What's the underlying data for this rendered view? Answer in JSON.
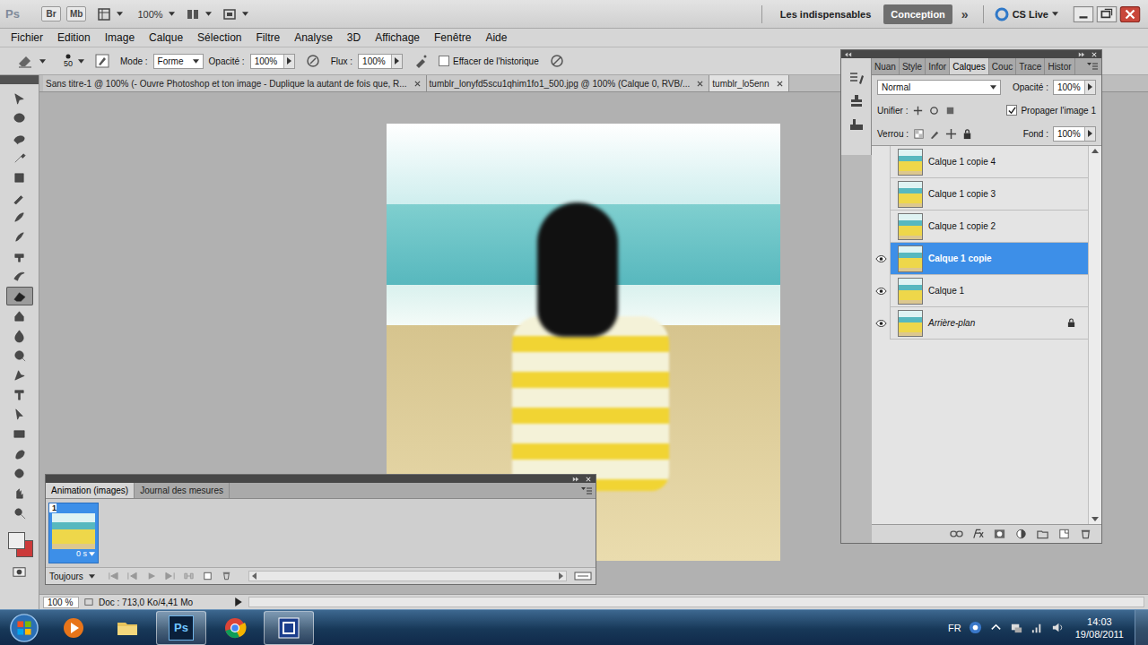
{
  "app_bar": {
    "logo": "Ps",
    "bridge_buttons": [
      "Br",
      "Mb"
    ],
    "zoom": "100%",
    "workspaces": [
      {
        "label": "Les indispensables",
        "selected": false
      },
      {
        "label": "Conception",
        "selected": true
      }
    ],
    "more": "»",
    "cs_live": "CS Live"
  },
  "menu": [
    "Fichier",
    "Edition",
    "Image",
    "Calque",
    "Sélection",
    "Filtre",
    "Analyse",
    "3D",
    "Affichage",
    "Fenêtre",
    "Aide"
  ],
  "options": {
    "brush_size": "50",
    "mode_label": "Mode :",
    "mode_value": "Forme",
    "opacity_label": "Opacité :",
    "opacity": "100%",
    "flow_label": "Flux :",
    "flow": "100%",
    "erase_history": {
      "label": "Effacer de l'historique",
      "checked": false
    }
  },
  "doc_tabs": [
    {
      "label": "Sans titre-1 @ 100% (- Ouvre Photoshop et ton image - Duplique la autant de fois que, R...",
      "selected": false
    },
    {
      "label": "tumblr_lonyfd5scu1qhim1fo1_500.jpg @ 100% (Calque 0, RVB/...",
      "selected": false
    },
    {
      "label": "tumblr_lo5enn",
      "selected": true
    }
  ],
  "tools": [
    {
      "selected": false
    },
    {
      "selected": false
    },
    {
      "selected": false
    },
    {
      "selected": false
    },
    {
      "selected": false
    },
    {
      "selected": false
    },
    {
      "selected": false
    },
    {
      "selected": false
    },
    {
      "selected": false
    },
    {
      "selected": false
    },
    {
      "selected": true
    },
    {
      "selected": false
    },
    {
      "selected": false
    },
    {
      "selected": false
    },
    {
      "selected": false
    },
    {
      "selected": false
    },
    {
      "selected": false
    },
    {
      "selected": false
    },
    {
      "selected": false
    },
    {
      "selected": false
    },
    {
      "selected": false
    },
    {
      "selected": false
    }
  ],
  "swatches": {
    "foreground": "#eeeeee",
    "background": "#cc3a3a"
  },
  "layers_panel": {
    "tabs": [
      {
        "label": "Nuan",
        "selected": false
      },
      {
        "label": "Style",
        "selected": false
      },
      {
        "label": "Infor",
        "selected": false
      },
      {
        "label": "Calques",
        "selected": true
      },
      {
        "label": "Couc",
        "selected": false
      },
      {
        "label": "Trace",
        "selected": false
      },
      {
        "label": "Histor",
        "selected": false
      }
    ],
    "blend_mode": "Normal",
    "opacity_label": "Opacité :",
    "opacity": "100%",
    "unify_label": "Unifier :",
    "propagate": {
      "label": "Propager l'image 1",
      "checked": true
    },
    "lock_label": "Verrou :",
    "fill_label": "Fond :",
    "fill": "100%",
    "layers": [
      {
        "name": "Calque 1 copie 4",
        "visible": false,
        "selected": false,
        "kind": "layer"
      },
      {
        "name": "Calque 1 copie 3",
        "visible": false,
        "selected": false,
        "kind": "layer"
      },
      {
        "name": "Calque 1 copie 2",
        "visible": false,
        "selected": false,
        "kind": "layer"
      },
      {
        "name": "Calque 1 copie",
        "visible": true,
        "selected": true,
        "kind": "layer"
      },
      {
        "name": "Calque 1",
        "visible": true,
        "selected": false,
        "kind": "layer"
      },
      {
        "name": "Arrière-plan",
        "visible": true,
        "selected": false,
        "kind": "background"
      }
    ]
  },
  "animation_panel": {
    "tabs": [
      {
        "label": "Animation (images)",
        "selected": true
      },
      {
        "label": "Journal des mesures",
        "selected": false
      }
    ],
    "frames": [
      {
        "number": "1",
        "delay": "0 s",
        "selected": true
      }
    ],
    "loop": "Toujours"
  },
  "status_bar": {
    "zoom": "100 %",
    "doc_info": "Doc : 713,0 Ko/4,41 Mo"
  },
  "taskbar": {
    "apps": [
      {
        "kind": "media",
        "label": "",
        "active": false
      },
      {
        "kind": "explorer",
        "label": "",
        "active": false
      },
      {
        "kind": "photoshop",
        "label": "Ps",
        "active": true
      },
      {
        "kind": "chrome",
        "label": "",
        "active": false
      },
      {
        "kind": "app",
        "label": "",
        "active": true
      }
    ],
    "language": "FR",
    "time": "14:03",
    "date": "19/08/2011"
  }
}
